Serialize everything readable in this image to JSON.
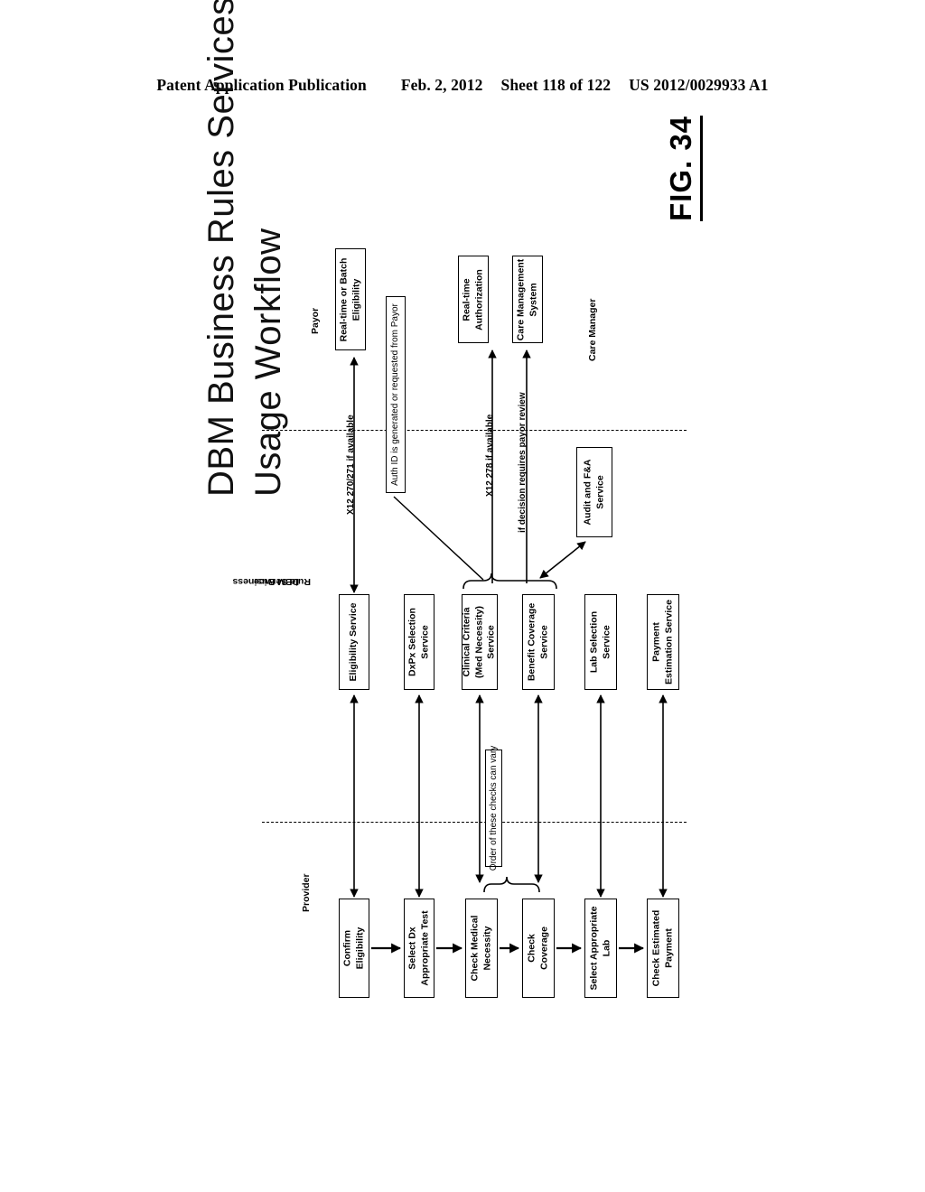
{
  "header": {
    "publication": "Patent Application Publication",
    "date": "Feb. 2, 2012",
    "sheet": "Sheet 118 of 122",
    "patent_number": "US 2012/0029933 A1"
  },
  "figure": {
    "label": "FIG. 34",
    "title_line1": "DBM Business Rules Services",
    "title_line2": "Usage Workflow"
  },
  "lanes": {
    "payor": "Payor",
    "care_manager": "Care Manager",
    "dbm": "DBM Business\nRule Service",
    "dbm_line1": "DBM Business",
    "dbm_line2": "Rule Service",
    "provider": "Provider"
  },
  "payor_nodes": [
    {
      "id": "realtime-batch-eligibility",
      "line1": "Real-time or Batch",
      "line2": "Eligibility"
    },
    {
      "id": "realtime-authorization",
      "line1": "Real-time",
      "line2": "Authorization"
    },
    {
      "id": "care-management-system",
      "line1": "Care Management",
      "line2": "System"
    }
  ],
  "dbm_nodes": [
    {
      "id": "eligibility-service",
      "line1": "Eligibility Service",
      "line2": ""
    },
    {
      "id": "dxpx-selection-service",
      "line1": "DxPx Selection",
      "line2": "Service"
    },
    {
      "id": "clinical-criteria-service",
      "line1": "Clinical Criteria",
      "line2": "(Med Necessity)",
      "line3": "Service"
    },
    {
      "id": "benefit-coverage-service",
      "line1": "Benefit Coverage",
      "line2": "Service"
    },
    {
      "id": "lab-selection-service",
      "line1": "Lab Selection",
      "line2": "Service"
    },
    {
      "id": "payment-estimation-service",
      "line1": "Payment",
      "line2": "Estimation Service"
    },
    {
      "id": "audit-fa-service",
      "line1": "Audit and F&A",
      "line2": "Service"
    }
  ],
  "provider_nodes": [
    {
      "id": "confirm-eligibility",
      "line1": "Confirm",
      "line2": "Eligibility"
    },
    {
      "id": "select-dx-appropriate-test",
      "line1": "Select Dx",
      "line2": "Appropriate Test"
    },
    {
      "id": "check-medical-necessity",
      "line1": "Check Medical",
      "line2": "Necessity"
    },
    {
      "id": "check-coverage",
      "line1": "Check",
      "line2": "Coverage"
    },
    {
      "id": "select-appropriate-lab",
      "line1": "Select Appropriate",
      "line2": "Lab"
    },
    {
      "id": "check-estimated-payment",
      "line1": "Check Estimated",
      "line2": "Payment"
    }
  ],
  "annotations": {
    "auth_id_note": "Auth ID is generated or requested from Payor",
    "order_note": "Order of these checks can vary",
    "edge_x12_270_271": "X12 270/271   if available",
    "edge_x12_278": "X12 278 if available",
    "edge_payor_review": "if decision requires  payor review"
  },
  "colors": {
    "ink": "#000000",
    "paper": "#ffffff"
  }
}
